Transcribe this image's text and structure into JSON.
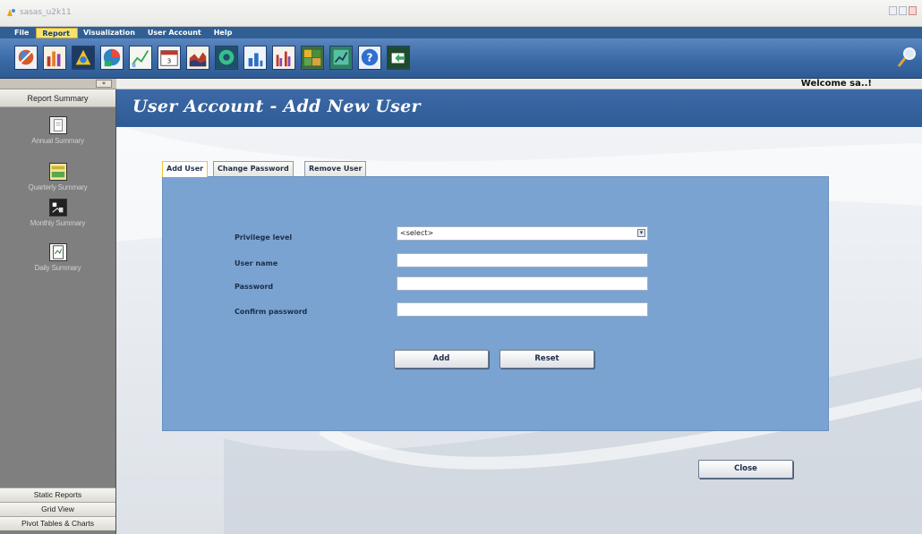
{
  "window": {
    "title": "sasas_u2k11",
    "app_icon": "app-logo-icon"
  },
  "menu": {
    "items": [
      {
        "label": "File",
        "active": false
      },
      {
        "label": "Report",
        "active": true
      },
      {
        "label": "Visualization",
        "active": false
      },
      {
        "label": "User Account",
        "active": false
      },
      {
        "label": "Help",
        "active": false
      }
    ]
  },
  "toolbar": {
    "icons": [
      "globe-report-icon",
      "bar-chart-icon",
      "scatter-plot-icon",
      "pie-chart-icon",
      "line-chart-icon",
      "calendar-icon",
      "area-chart-icon",
      "donut-chart-icon",
      "column-chart-icon",
      "grouped-bar-icon",
      "heatmap-icon",
      "trend-chart-icon",
      "help-icon",
      "export-icon"
    ],
    "right_icon": "zoom-icon"
  },
  "header": {
    "welcome": "Welcome sa..!"
  },
  "sidebar": {
    "title": "Report Summary",
    "items": [
      {
        "label": "Annual Summary",
        "icon": "document-icon"
      },
      {
        "label": "Quarterly Summary",
        "icon": "quarterly-chart-icon"
      },
      {
        "label": "Monthly Summary",
        "icon": "monthly-chart-icon"
      },
      {
        "label": "Daily Summary",
        "icon": "daily-report-icon"
      }
    ],
    "footer": [
      {
        "label": "Static Reports"
      },
      {
        "label": "Grid View"
      },
      {
        "label": "Pivot Tables & Charts"
      }
    ]
  },
  "page": {
    "title": "User Account - Add New User",
    "tabs": [
      {
        "label": "Add User",
        "active": true
      },
      {
        "label": "Change Password",
        "active": false
      },
      {
        "label": "Remove User",
        "active": false
      }
    ],
    "form": {
      "privilege_label": "Privilege level",
      "privilege_value": "<select>",
      "username_label": "User name",
      "username_value": "",
      "password_label": "Password",
      "password_value": "",
      "confirm_label": "Confirm password",
      "confirm_value": ""
    },
    "buttons": {
      "add": "Add",
      "reset": "Reset",
      "close": "Close"
    }
  },
  "colors": {
    "menu_bg": "#315f93",
    "toolbar_bg": "#3a6aa6",
    "panel_bg": "#7aa3d2",
    "active_tab_border": "#f1c232"
  }
}
